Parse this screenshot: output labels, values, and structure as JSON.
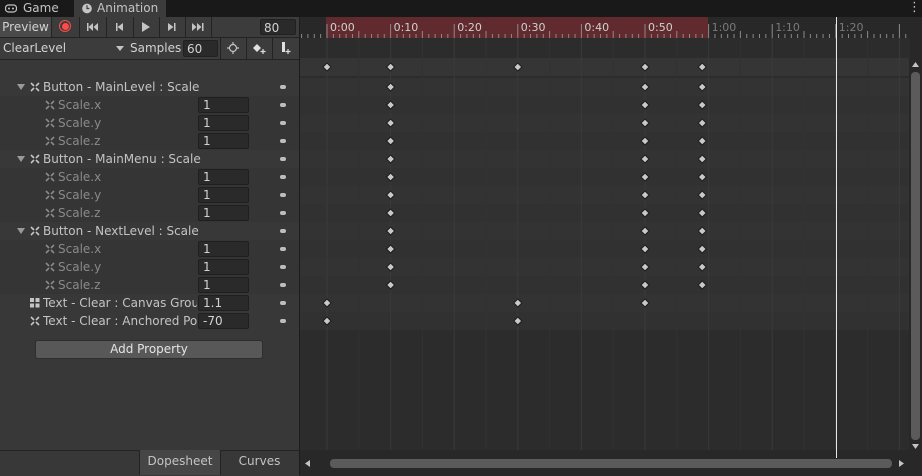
{
  "tabs": [
    {
      "label": "Game",
      "icon": "gamepad-icon"
    },
    {
      "label": "Animation",
      "icon": "clock-icon"
    }
  ],
  "toolbar": {
    "preview_label": "Preview",
    "current_frame": "80",
    "clip_name": "ClearLevel",
    "samples_label": "Samples",
    "samples_value": "60"
  },
  "properties": [
    {
      "label": "Button - MainLevel : Scale",
      "kind": "header",
      "value": null
    },
    {
      "label": "Scale.x",
      "kind": "child",
      "value": "1"
    },
    {
      "label": "Scale.y",
      "kind": "child",
      "value": "1"
    },
    {
      "label": "Scale.z",
      "kind": "child",
      "value": "1"
    },
    {
      "label": "Button - MainMenu : Scale",
      "kind": "header",
      "value": null
    },
    {
      "label": "Scale.x",
      "kind": "child",
      "value": "1"
    },
    {
      "label": "Scale.y",
      "kind": "child",
      "value": "1"
    },
    {
      "label": "Scale.z",
      "kind": "child",
      "value": "1"
    },
    {
      "label": "Button - NextLevel : Scale",
      "kind": "header",
      "value": null
    },
    {
      "label": "Scale.x",
      "kind": "child",
      "value": "1"
    },
    {
      "label": "Scale.y",
      "kind": "child",
      "value": "1"
    },
    {
      "label": "Scale.z",
      "kind": "child",
      "value": "1"
    },
    {
      "label": "Text - Clear : Canvas Group",
      "kind": "single",
      "value": "1.1"
    },
    {
      "label": "Text - Clear : Anchored Position",
      "kind": "single",
      "value": "-70"
    }
  ],
  "add_property_label": "Add Property",
  "bottom_tabs": {
    "dopesheet": "Dopesheet",
    "curves": "Curves"
  },
  "ruler_labels": [
    "0:00",
    "0:10",
    "0:20",
    "0:30",
    "0:40",
    "0:50",
    "1:00",
    "1:10",
    "1:20"
  ],
  "keyframes": {
    "summary": [
      0,
      10,
      30,
      50,
      59
    ],
    "rows": [
      [
        10,
        50,
        59
      ],
      [
        10,
        50,
        59
      ],
      [
        10,
        50,
        59
      ],
      [
        10,
        50,
        59
      ],
      [
        10,
        50,
        59
      ],
      [
        10,
        50,
        59
      ],
      [
        10,
        50,
        59
      ],
      [
        10,
        50,
        59
      ],
      [
        10,
        50,
        59
      ],
      [
        10,
        50,
        59
      ],
      [
        10,
        50,
        59
      ],
      [
        10,
        50,
        59
      ],
      [
        0,
        30,
        50
      ],
      [
        0,
        30
      ]
    ]
  },
  "clip_end_frame": 60,
  "playhead_frame": 80,
  "colors": {
    "record": "#ff4a4a",
    "clip_range": "#602a2e",
    "keyframe": "#c9c9c9"
  }
}
